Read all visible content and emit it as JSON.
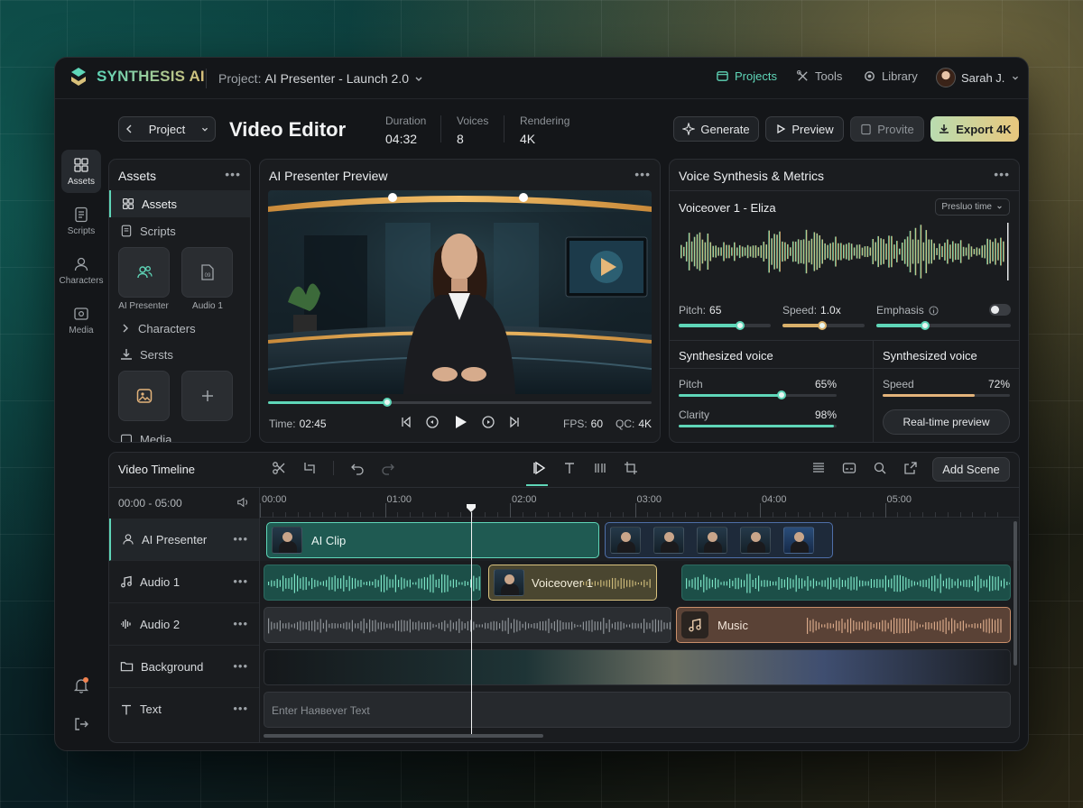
{
  "app": {
    "brand": "SYNTHESIS AI",
    "project_label": "Project:",
    "project_name": "AI Presenter - Launch 2.0"
  },
  "nav": {
    "projects": "Projects",
    "tools": "Tools",
    "library": "Library",
    "user": "Sarah J."
  },
  "header": {
    "back_label": "Project",
    "title": "Video Editor",
    "stats": [
      {
        "label": "Duration",
        "value": "04:32"
      },
      {
        "label": "Voices",
        "value": "8"
      },
      {
        "label": "Rendering",
        "value": "4K"
      }
    ],
    "generate": "Generate",
    "preview": "Preview",
    "provite": "Provite",
    "export": "Export 4K"
  },
  "rail": {
    "assets": "Assets",
    "scripts": "Scripts",
    "characters": "Characters",
    "media": "Media"
  },
  "assets": {
    "title": "Assets",
    "assets_item": "Assets",
    "scripts_item": "Scripts",
    "tile1": "AI Presenter",
    "tile2": "Audio 1",
    "characters": "Characters",
    "sersts": "Sersts",
    "media": "Media"
  },
  "preview": {
    "title": "AI Presenter Preview",
    "time_label": "Time:",
    "time": "02:45",
    "fps_label": "FPS:",
    "fps": "60",
    "qc_label": "QC:",
    "qc": "4K",
    "progress": 0.31
  },
  "voice": {
    "title": "Voice Synthesis & Metrics",
    "voiceover": "Voiceover 1 - Eliza",
    "select": "Presluo time",
    "pitch_label": "Pitch:",
    "pitch": "65",
    "pitch_level": 0.67,
    "speed_label": "Speed:",
    "speed": "1.0x",
    "speed_level": 0.48,
    "emphasis_label": "Emphasis",
    "emphasis_level": 0.36,
    "emphasis_on": false
  },
  "synth": {
    "title_left": "Synthesized voice",
    "title_right": "Synthesized voice",
    "pitch_label": "Pitch",
    "pitch_pct": "65%",
    "pitch_level": 0.65,
    "clarity_label": "Clarity",
    "clarity_pct": "98%",
    "clarity_level": 0.98,
    "speed_label": "Speed",
    "speed_pct": "72%",
    "speed_level": 0.72,
    "realtime": "Real-time preview"
  },
  "timeline": {
    "title": "Video Timeline",
    "add_scene": "Add Scene",
    "range": "00:00 - 05:00",
    "ruler": [
      "00:00",
      "01:00",
      "02:00",
      "03:00",
      "04:00",
      "05:00"
    ],
    "playhead_time": 1.69,
    "tracks": [
      "AI Presenter",
      "Audio 1",
      "Audio 2",
      "Background",
      "Text"
    ],
    "clip_ai": "AI Clip",
    "clip_voiceover": "Voiceover 1",
    "clip_music": "Music",
    "text_placeholder": "Enter Haявever Text"
  },
  "colors": {
    "accent": "#5fd6b8",
    "gold": "#d9b06a",
    "export": "#e3c57a"
  }
}
